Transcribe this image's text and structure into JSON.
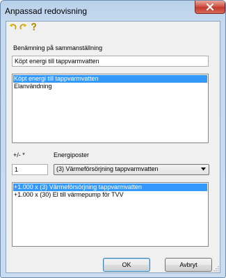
{
  "window": {
    "title": "Anpassad redovisning",
    "close_label": "close"
  },
  "toolbar": {
    "icons": [
      "undo-icon",
      "redo-icon",
      "help-icon"
    ]
  },
  "name_section": {
    "label": "Benämning på sammanställning",
    "value": "Köpt energi till tappvarmvatten"
  },
  "top_list": {
    "items": [
      {
        "label": "Köpt energi till tappvarmvatten",
        "selected": true
      },
      {
        "label": "Elanvändning",
        "selected": false
      }
    ]
  },
  "factor_section": {
    "label": "+/- *",
    "value": "1"
  },
  "energy_section": {
    "label": "Energiposter",
    "selected": "(3) Värmeförsörjning tappvarmvatten"
  },
  "bottom_list": {
    "items": [
      {
        "label": "+1.000 x (3) Värmeförsörjning tappvarmvatten",
        "selected": true
      },
      {
        "label": "+1.000 x (30) El till värmepump för TVV",
        "selected": false
      }
    ]
  },
  "buttons": {
    "ok": "OK",
    "cancel": "Avbryt"
  },
  "colors": {
    "selection": "#3399ff",
    "close_button": "#c23a2d",
    "frame": "#c5d9ef"
  }
}
